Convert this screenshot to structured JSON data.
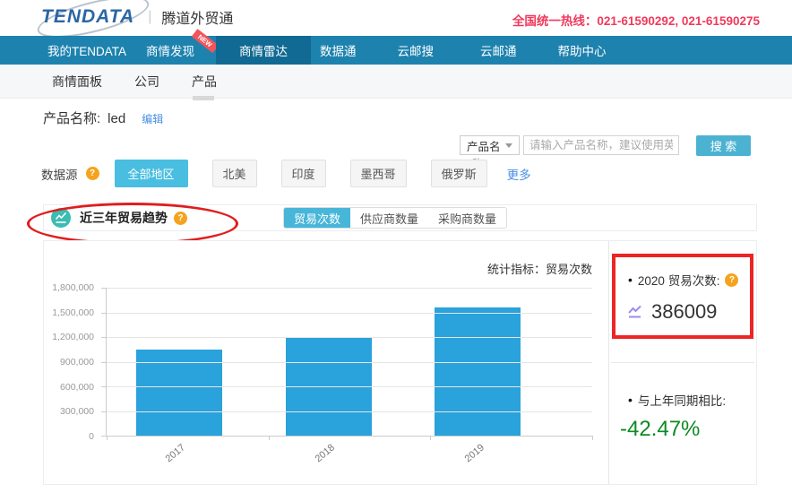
{
  "header": {
    "logo_text": "TENDATA",
    "logo_divider": "|",
    "logo_subtitle": "腾道外贸通",
    "hotline_label": "全国统一热线：",
    "hotline_numbers": "021-61590292, 021-61590275"
  },
  "nav": {
    "items": [
      {
        "label": "我的TENDATA",
        "active": false
      },
      {
        "label": "商情发现",
        "active": false,
        "badge": "NEW"
      },
      {
        "label": "商情雷达",
        "active": true
      },
      {
        "label": "数据通",
        "active": false
      },
      {
        "label": "云邮搜",
        "active": false
      },
      {
        "label": "云邮通",
        "active": false
      },
      {
        "label": "帮助中心",
        "active": false
      }
    ]
  },
  "subnav": {
    "items": [
      "商情面板",
      "公司",
      "产品"
    ],
    "active": "产品",
    "search": {
      "category_value": "产品名",
      "placeholder_line1": "请输入产品名称，建议使用英",
      "placeholder_overflow": "称",
      "button_label": "搜 索"
    }
  },
  "product": {
    "label": "产品名称:",
    "value": "led",
    "edit_label": "编辑"
  },
  "filters": {
    "label": "数据源",
    "options": [
      "全部地区",
      "北美",
      "印度",
      "墨西哥",
      "俄罗斯"
    ],
    "active": "全部地区",
    "more_label": "更多"
  },
  "trend": {
    "title": "近三年贸易趋势",
    "tabs": [
      "贸易次数",
      "供应商数量",
      "采购商数量"
    ],
    "active_tab": "贸易次数",
    "indicator_label": "统计指标：贸易次数"
  },
  "chart_data": {
    "type": "bar",
    "title": "近三年贸易趋势",
    "categories": [
      "2017",
      "2018",
      "2019"
    ],
    "values": [
      1050000,
      1190000,
      1560000
    ],
    "ylim": [
      0,
      1800000
    ],
    "yticks": [
      "1,800,000",
      "1,500,000",
      "1,200,000",
      "900,000",
      "600,000",
      "300,000",
      "0"
    ],
    "xlabel": "",
    "ylabel": "",
    "grid": true,
    "legend_position": "none",
    "bar_color": "#2aa2dc"
  },
  "summary": {
    "bullet": "•",
    "year_stat": {
      "label": "2020 贸易次数:",
      "value": "386009"
    },
    "comparison": {
      "label": "与上年同期相比:",
      "value": "-42.47%"
    }
  },
  "icons": {
    "help_glyph": "?"
  },
  "colors": {
    "nav_bg": "#1d82ae",
    "nav_active_bg": "#116a93",
    "accent_cyan": "#47b6d9",
    "bar_blue": "#2aa2dc",
    "annotation_red": "#ec2525",
    "hotline_red": "#f03a5c",
    "help_orange": "#f5a31d",
    "teal_icon": "#3cbcb2",
    "purple_icon": "#9b8cf0",
    "positive_green": "#0e8a22",
    "link_blue": "#4a90e2",
    "logo_blue": "#2b66a3"
  }
}
